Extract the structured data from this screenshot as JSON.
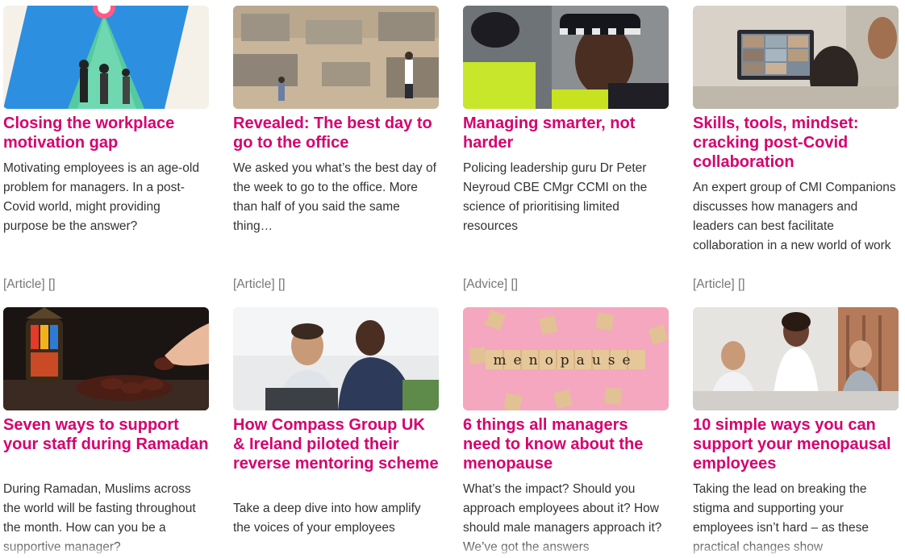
{
  "cards": [
    {
      "title": "Closing the workplace motivation gap",
      "description": "Motivating employees is an age-old problem for managers. In a post-Covid world, might providing purpose be the answer?",
      "type": "[Article]",
      "extra": "[]",
      "image_icon": "motivation-illustration"
    },
    {
      "title": "Revealed: The best day to go to the office",
      "description": "We asked you what’s the best day of the week to go to the office. More than half of you said the same thing…",
      "type": "[Article]",
      "extra": "[]",
      "image_icon": "office-photo"
    },
    {
      "title": "Managing smarter, not harder",
      "description": "Policing leadership guru Dr Peter Neyroud CBE CMgr CCMI on the science of prioritising limited resources",
      "type": "[Advice]",
      "extra": "[]",
      "image_icon": "police-officer-photo"
    },
    {
      "title": "Skills, tools, mindset: cracking post-Covid collaboration",
      "description": "An expert group of CMI Companions discusses how managers and leaders can best facilitate collaboration in a new world of work",
      "type": "[Article]",
      "extra": "[]",
      "image_icon": "video-call-photo"
    },
    {
      "title": "Seven ways to support your staff during Ramadan",
      "description": "During Ramadan, Muslims across the world will be fasting throughout the month. How can you be a supportive manager?",
      "image_icon": "ramadan-lantern-photo"
    },
    {
      "title": "How Compass Group UK & Ireland piloted their reverse mentoring scheme",
      "description": "Take a deep dive into how amplify the voices of your employees",
      "image_icon": "mentoring-photo"
    },
    {
      "title": "6 things all managers need to know about the menopause",
      "description": "What’s the impact? Should you approach employees about it? How should male managers approach it? We’ve got the answers",
      "image_icon": "menopause-blocks-photo",
      "image_word": "menopause"
    },
    {
      "title": "10 simple ways you can support your menopausal employees",
      "description": "Taking the lead on breaking the stigma and supporting your employees isn’t hard – as these practical changes show",
      "image_icon": "team-meeting-photo"
    }
  ]
}
